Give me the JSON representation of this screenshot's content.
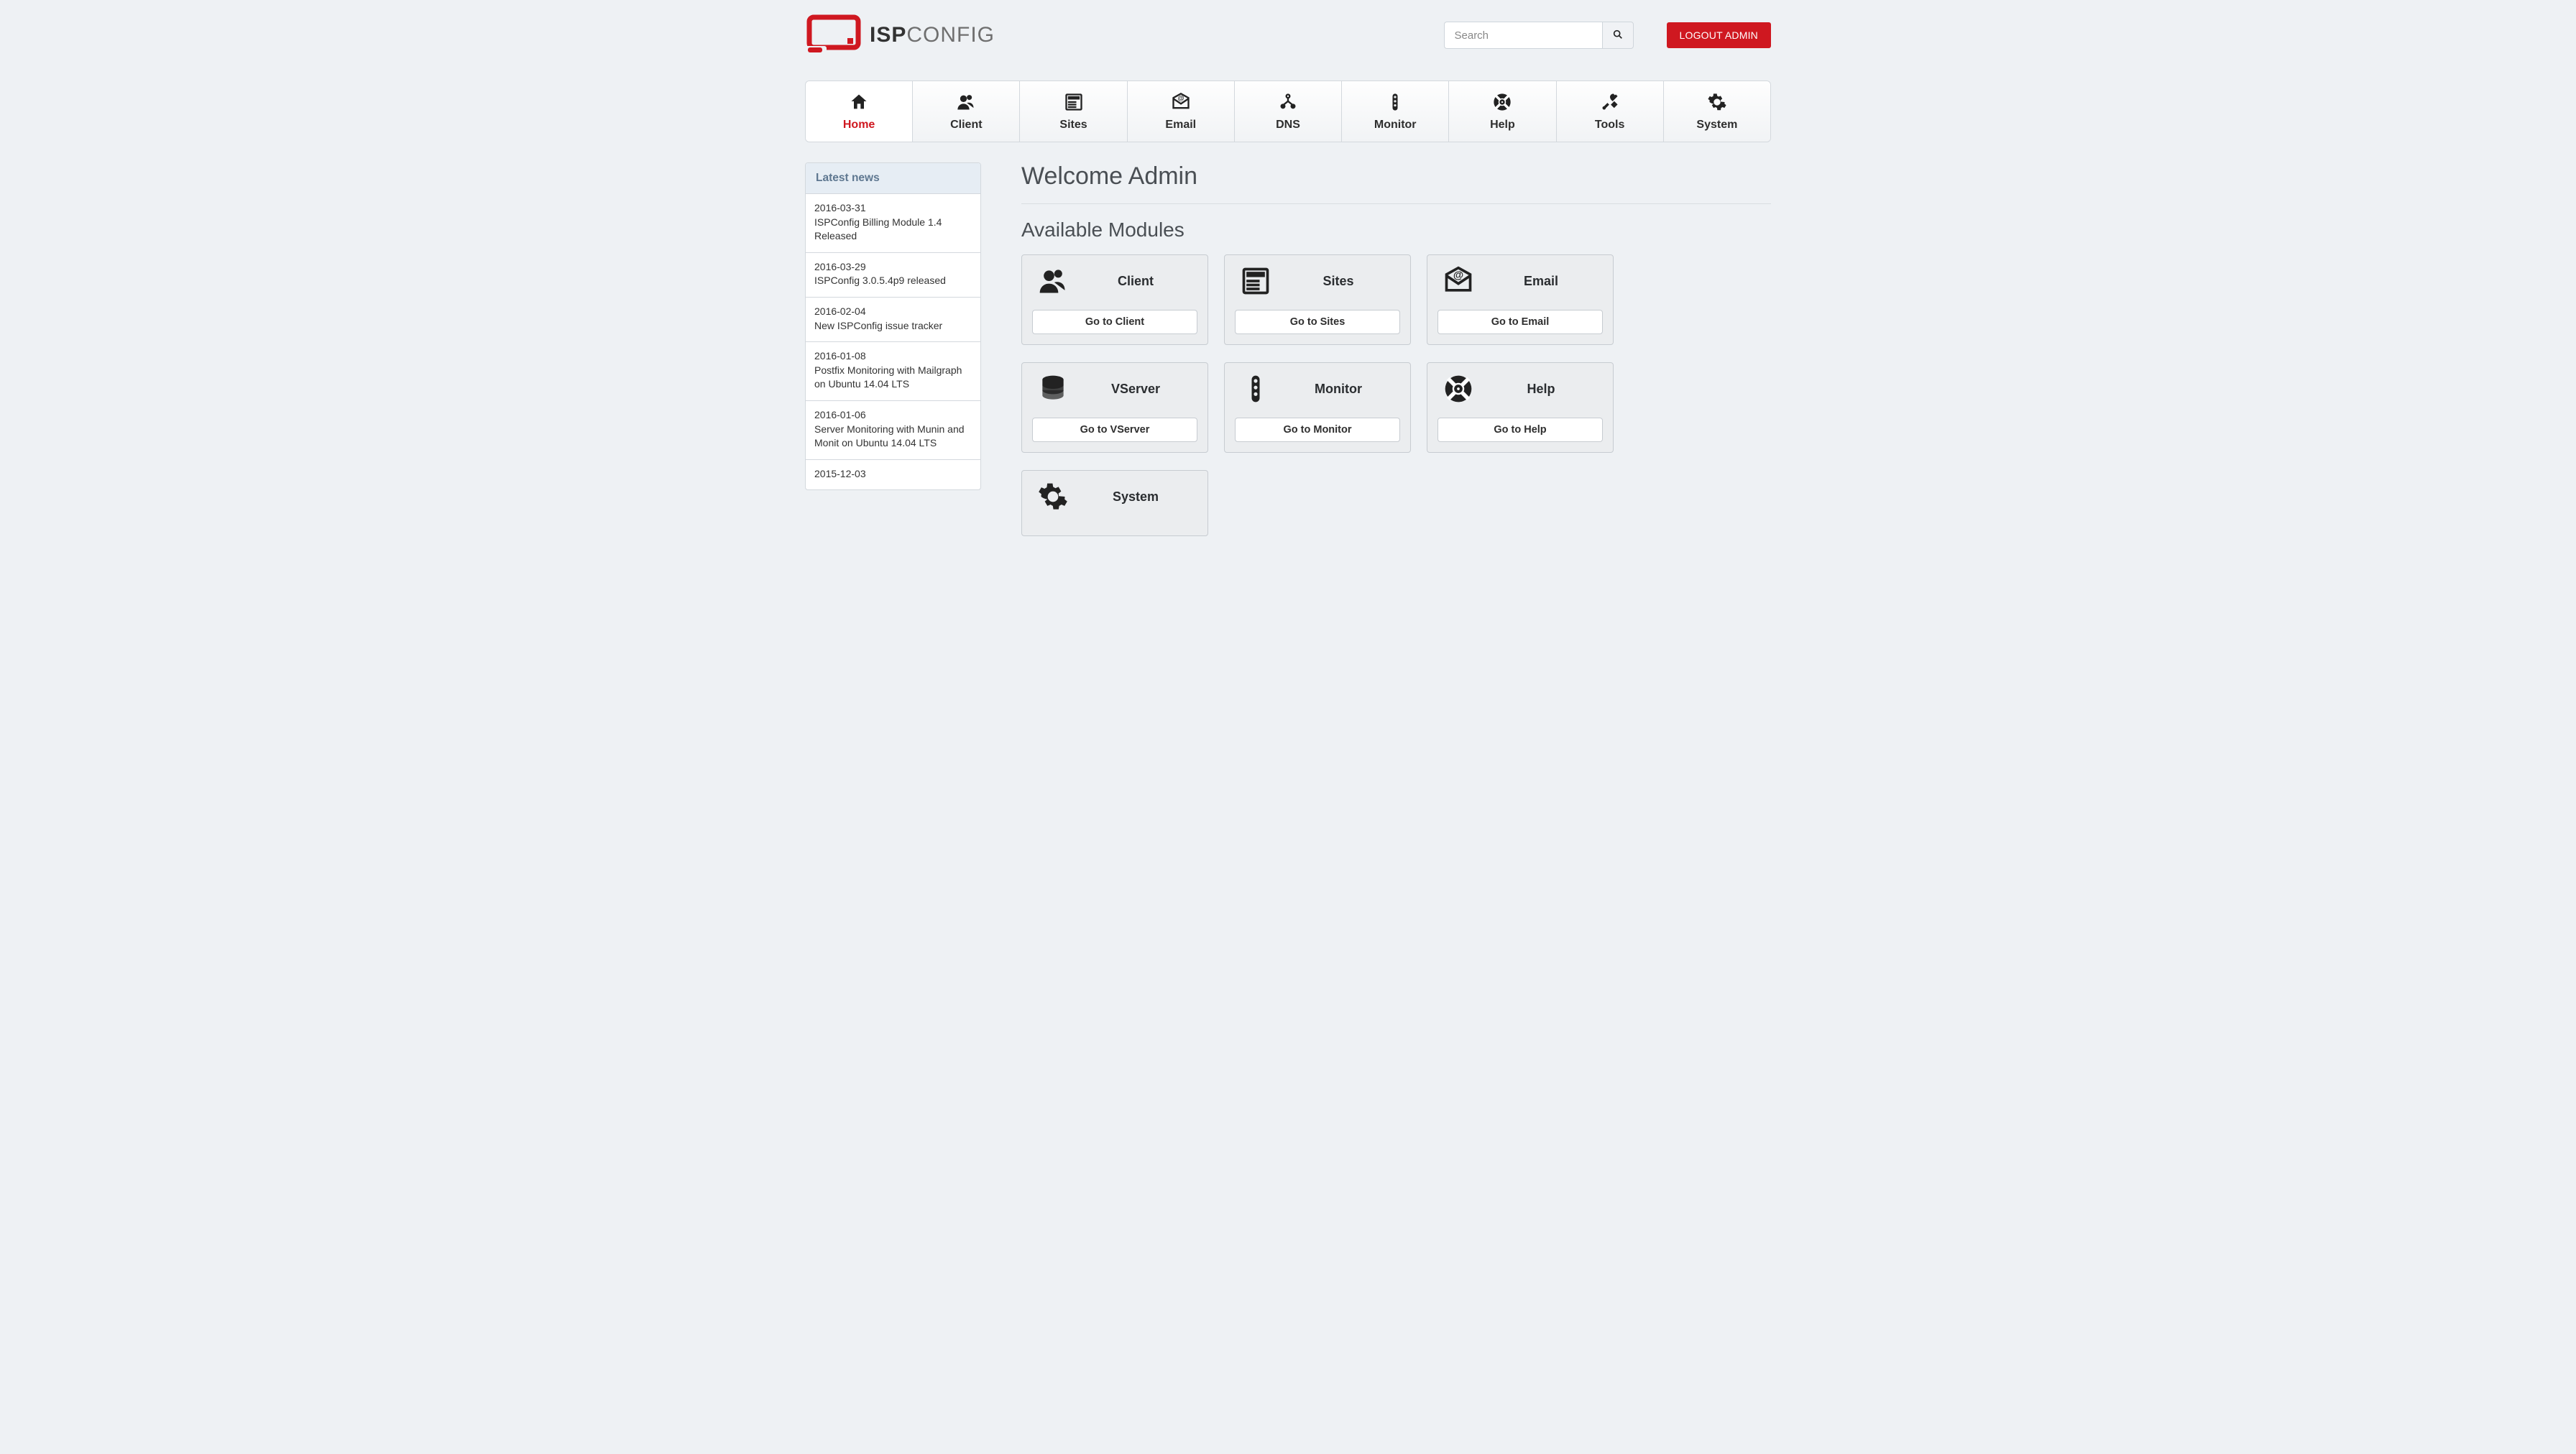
{
  "brand": {
    "bold": "ISP",
    "thin": "CONFIG"
  },
  "search": {
    "placeholder": "Search"
  },
  "logout_label": "LOGOUT ADMIN",
  "nav": [
    {
      "key": "home",
      "label": "Home",
      "active": true
    },
    {
      "key": "client",
      "label": "Client",
      "active": false
    },
    {
      "key": "sites",
      "label": "Sites",
      "active": false
    },
    {
      "key": "email",
      "label": "Email",
      "active": false
    },
    {
      "key": "dns",
      "label": "DNS",
      "active": false
    },
    {
      "key": "monitor",
      "label": "Monitor",
      "active": false
    },
    {
      "key": "help",
      "label": "Help",
      "active": false
    },
    {
      "key": "tools",
      "label": "Tools",
      "active": false
    },
    {
      "key": "system",
      "label": "System",
      "active": false
    }
  ],
  "news": {
    "header": "Latest news",
    "items": [
      {
        "date": "2016-03-31",
        "title": "ISPConfig Billing Module 1.4 Released"
      },
      {
        "date": "2016-03-29",
        "title": "ISPConfig 3.0.5.4p9 released"
      },
      {
        "date": "2016-02-04",
        "title": "New ISPConfig issue tracker"
      },
      {
        "date": "2016-01-08",
        "title": "Postfix Monitoring with Mailgraph on Ubuntu 14.04 LTS"
      },
      {
        "date": "2016-01-06",
        "title": "Server Monitoring with Munin and Monit on Ubuntu 14.04 LTS"
      },
      {
        "date": "2015-12-03",
        "title": ""
      }
    ]
  },
  "welcome_title": "Welcome Admin",
  "modules_title": "Available Modules",
  "modules": [
    {
      "key": "client",
      "title": "Client",
      "button": "Go to Client"
    },
    {
      "key": "sites",
      "title": "Sites",
      "button": "Go to Sites"
    },
    {
      "key": "email",
      "title": "Email",
      "button": "Go to Email"
    },
    {
      "key": "vserver",
      "title": "VServer",
      "button": "Go to VServer"
    },
    {
      "key": "monitor",
      "title": "Monitor",
      "button": "Go to Monitor"
    },
    {
      "key": "help",
      "title": "Help",
      "button": "Go to Help"
    },
    {
      "key": "system",
      "title": "System",
      "button": ""
    }
  ]
}
